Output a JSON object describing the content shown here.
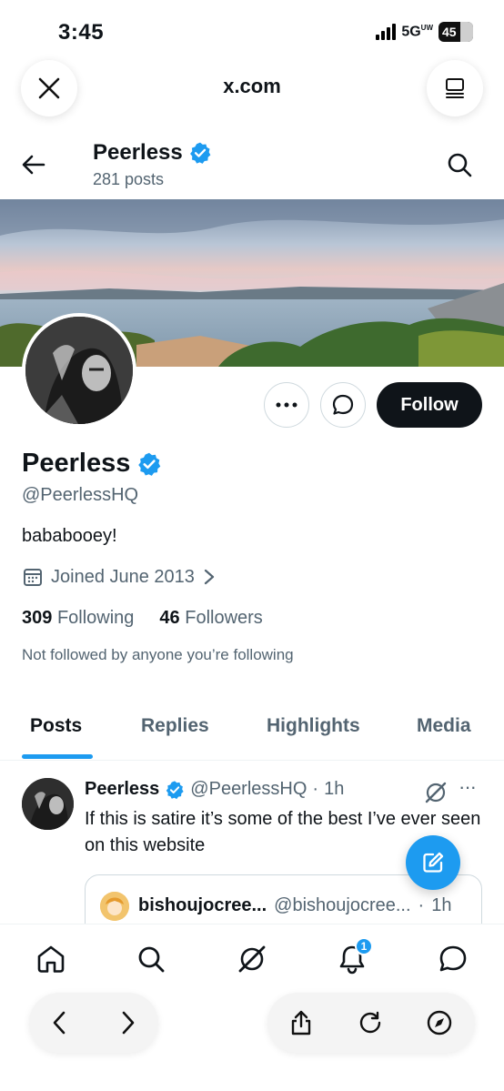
{
  "status_bar": {
    "time": "3:45",
    "network": "5G",
    "network_sup": "UW",
    "battery": "45"
  },
  "browser": {
    "url": "x.com"
  },
  "profile_header": {
    "name": "Peerless",
    "post_count": "281 posts"
  },
  "profile": {
    "name": "Peerless",
    "handle": "@PeerlessHQ",
    "bio": "bababooey!",
    "joined": "Joined June 2013",
    "following_count": "309",
    "following_label": "Following",
    "followers_count": "46",
    "followers_label": "Followers",
    "mutuals_note": "Not followed by anyone you’re following",
    "follow_button": "Follow"
  },
  "tabs": [
    "Posts",
    "Replies",
    "Highlights",
    "Media"
  ],
  "tweet": {
    "name": "Peerless",
    "handle": "@PeerlessHQ",
    "separator": "·",
    "time": "1h",
    "text": "If this is satire it’s some of the best I’ve ever seen on this website",
    "more": "···",
    "quote": {
      "name": "bishoujocree...",
      "handle": "@bishoujocree...",
      "separator": "·",
      "time": "1h"
    }
  },
  "notifications_badge": "1",
  "icons": {
    "status": [
      "signal-icon",
      "battery-icon"
    ],
    "browser_top": [
      "close-icon",
      "reader-icon"
    ],
    "profile": [
      "back-arrow-icon",
      "search-icon",
      "verified-badge-icon",
      "more-icon",
      "message-icon",
      "calendar-icon",
      "chevron-right-icon"
    ],
    "bottom_nav": [
      "home-icon",
      "search-icon",
      "grok-icon",
      "bell-icon",
      "messages-icon"
    ],
    "browser_bottom": [
      "back-icon",
      "forward-icon",
      "share-icon",
      "reload-icon",
      "compass-icon"
    ],
    "fab": "compose-icon"
  },
  "colors": {
    "accent": "#1d9bf0",
    "text": "#0f1419",
    "secondary": "#536471",
    "follow_bg": "#0f1419"
  }
}
